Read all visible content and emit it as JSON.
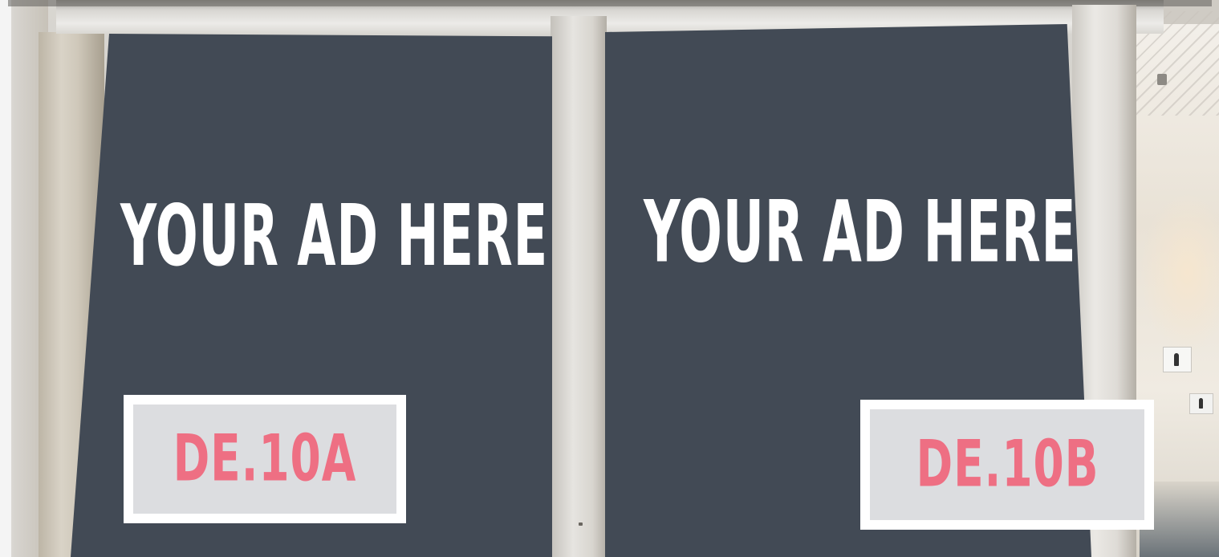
{
  "billboards": [
    {
      "headline": "YOUR AD HERE",
      "code": "DE.10A"
    },
    {
      "headline": "YOUR AD HERE",
      "code": "DE.10B"
    }
  ],
  "colors": {
    "panel": "#424a55",
    "headline_text": "#ffffff",
    "tag_text": "#ee6f83",
    "tag_fill": "#dcdde0",
    "tag_border": "#ffffff"
  },
  "icons": [
    "spotlight-icon",
    "restroom-sign-icon"
  ]
}
